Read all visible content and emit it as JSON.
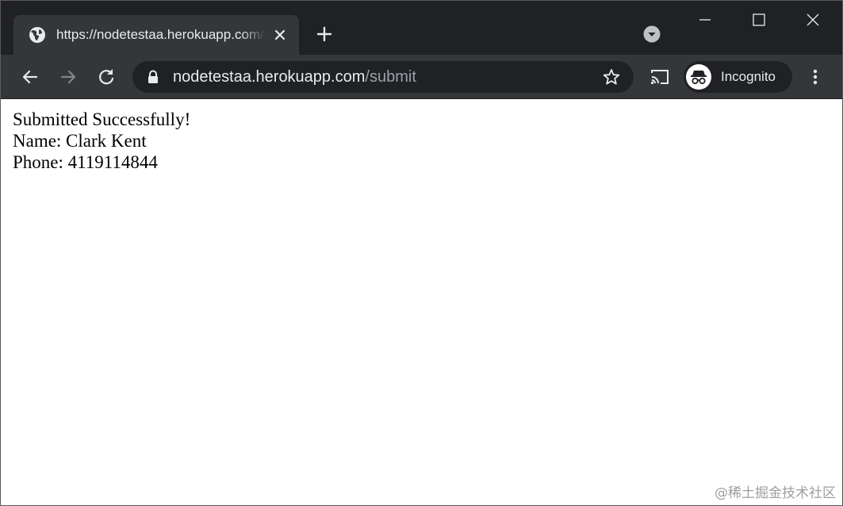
{
  "browser": {
    "tab": {
      "title": "https://nodetestaa.herokuapp.com/submit",
      "icon": "globe-icon"
    },
    "address_bar": {
      "host": "nodetestaa.herokuapp.com",
      "path": "/submit"
    },
    "profile": {
      "label": "Incognito",
      "icon": "incognito-icon"
    },
    "colors": {
      "frame": "#202124",
      "toolbar": "#35363a",
      "text": "#e8eaed",
      "muted": "#9aa0a6"
    }
  },
  "page": {
    "lines": [
      "Submitted Successfully!",
      "Name: Clark Kent",
      "Phone: 4119114844"
    ]
  },
  "watermark": "@稀土掘金技术社区"
}
